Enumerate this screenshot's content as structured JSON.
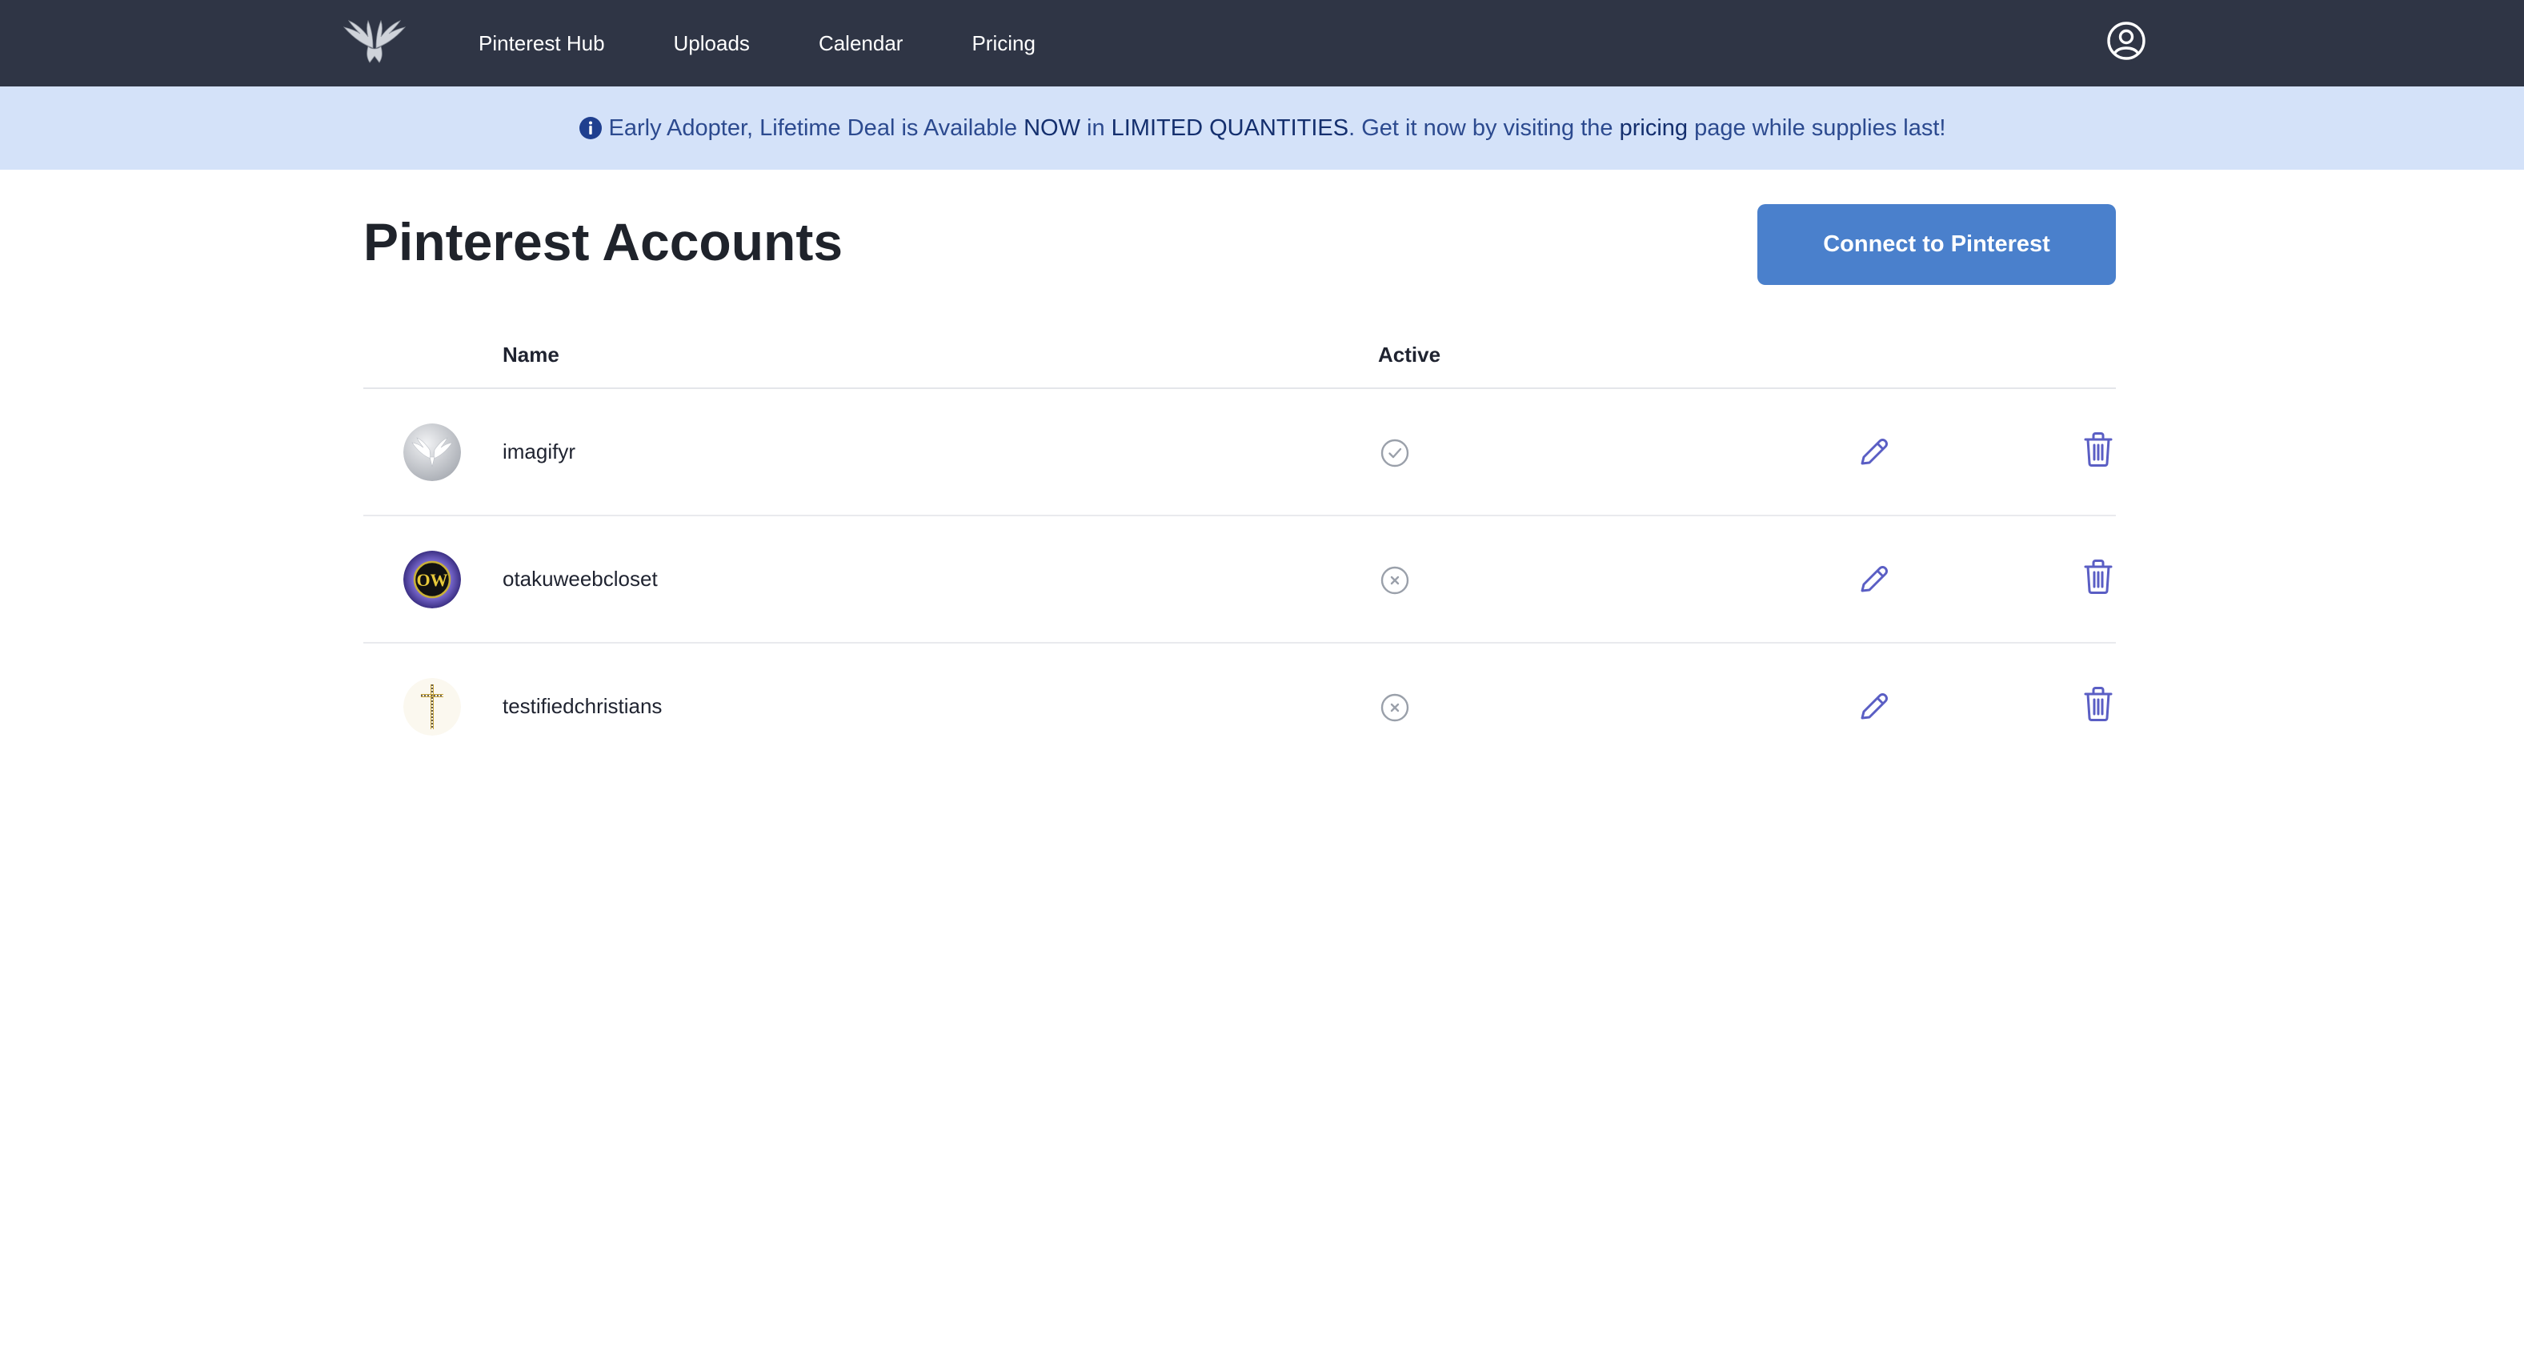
{
  "nav": {
    "logo": "winged-logo",
    "links": [
      {
        "label": "Pinterest Hub"
      },
      {
        "label": "Uploads"
      },
      {
        "label": "Calendar"
      },
      {
        "label": "Pricing"
      }
    ],
    "account_icon": "user-circle-icon"
  },
  "banner": {
    "icon": "info-icon",
    "text_1": "Early Adopter, Lifetime Deal is Available ",
    "now": "NOW",
    "text_2": " in ",
    "limited": "LIMITED QUANTITIES",
    "text_3": ". Get it now by visiting the ",
    "pricing_link": "pricing",
    "text_4": " page while supplies last!"
  },
  "header": {
    "title": "Pinterest Accounts",
    "connect_label": "Connect to Pinterest"
  },
  "table": {
    "columns": {
      "name": "Name",
      "active": "Active"
    },
    "rows": [
      {
        "name": "imagifyr",
        "active": true,
        "avatar": "winged-avatar"
      },
      {
        "name": "otakuweebcloset",
        "active": false,
        "avatar": "ow-avatar"
      },
      {
        "name": "testifiedchristians",
        "active": false,
        "avatar": "cross-avatar"
      }
    ]
  },
  "colors": {
    "nav_bg": "#2f3545",
    "banner_bg": "#d4e2f9",
    "banner_text": "#2c4a8f",
    "primary_button": "#4a80cc",
    "action_icon": "#5a5ec4",
    "status_icon": "#9aa0aa"
  }
}
